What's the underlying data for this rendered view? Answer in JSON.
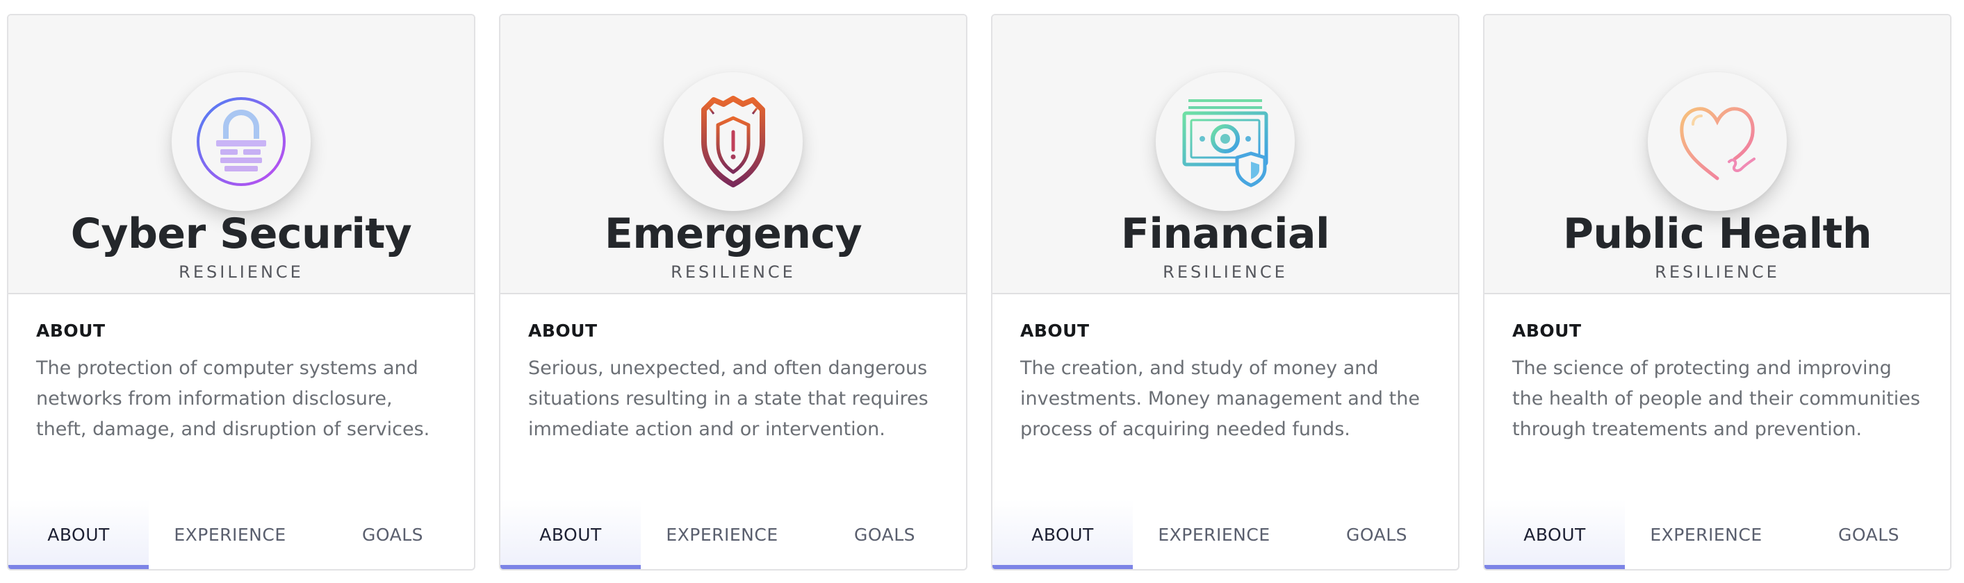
{
  "cards": [
    {
      "title": "Cyber Security",
      "subtitle": "RESILIENCE",
      "icon": "padlock-icon",
      "about_heading": "ABOUT",
      "description": "The protection of computer systems and networks from information disclosure, theft, damage, and disruption of services.",
      "tabs": [
        "ABOUT",
        "EXPERIENCE",
        "GOALS"
      ],
      "active_tab": "ABOUT"
    },
    {
      "title": "Emergency",
      "subtitle": "RESILIENCE",
      "icon": "shield-alert-icon",
      "about_heading": "ABOUT",
      "description": "Serious, unexpected, and often dangerous situations resulting in a state that requires immediate action and or intervention.",
      "tabs": [
        "ABOUT",
        "EXPERIENCE",
        "GOALS"
      ],
      "active_tab": "ABOUT"
    },
    {
      "title": "Financial",
      "subtitle": "RESILIENCE",
      "icon": "money-shield-icon",
      "about_heading": "ABOUT",
      "description": "The creation, and study of money and investments. Money management and the process of acquiring needed funds.",
      "tabs": [
        "ABOUT",
        "EXPERIENCE",
        "GOALS"
      ],
      "active_tab": "ABOUT"
    },
    {
      "title": "Public Health",
      "subtitle": "RESILIENCE",
      "icon": "heart-icon",
      "about_heading": "ABOUT",
      "description": "The science of protecting and improving the health of people and their communities through treatements and prevention.",
      "tabs": [
        "ABOUT",
        "EXPERIENCE",
        "GOALS"
      ],
      "active_tab": "ABOUT"
    }
  ],
  "colors": {
    "accent": "#7c84e6",
    "header_bg": "#f6f6f6",
    "title": "#24272b",
    "text_muted": "#6b6f75"
  }
}
